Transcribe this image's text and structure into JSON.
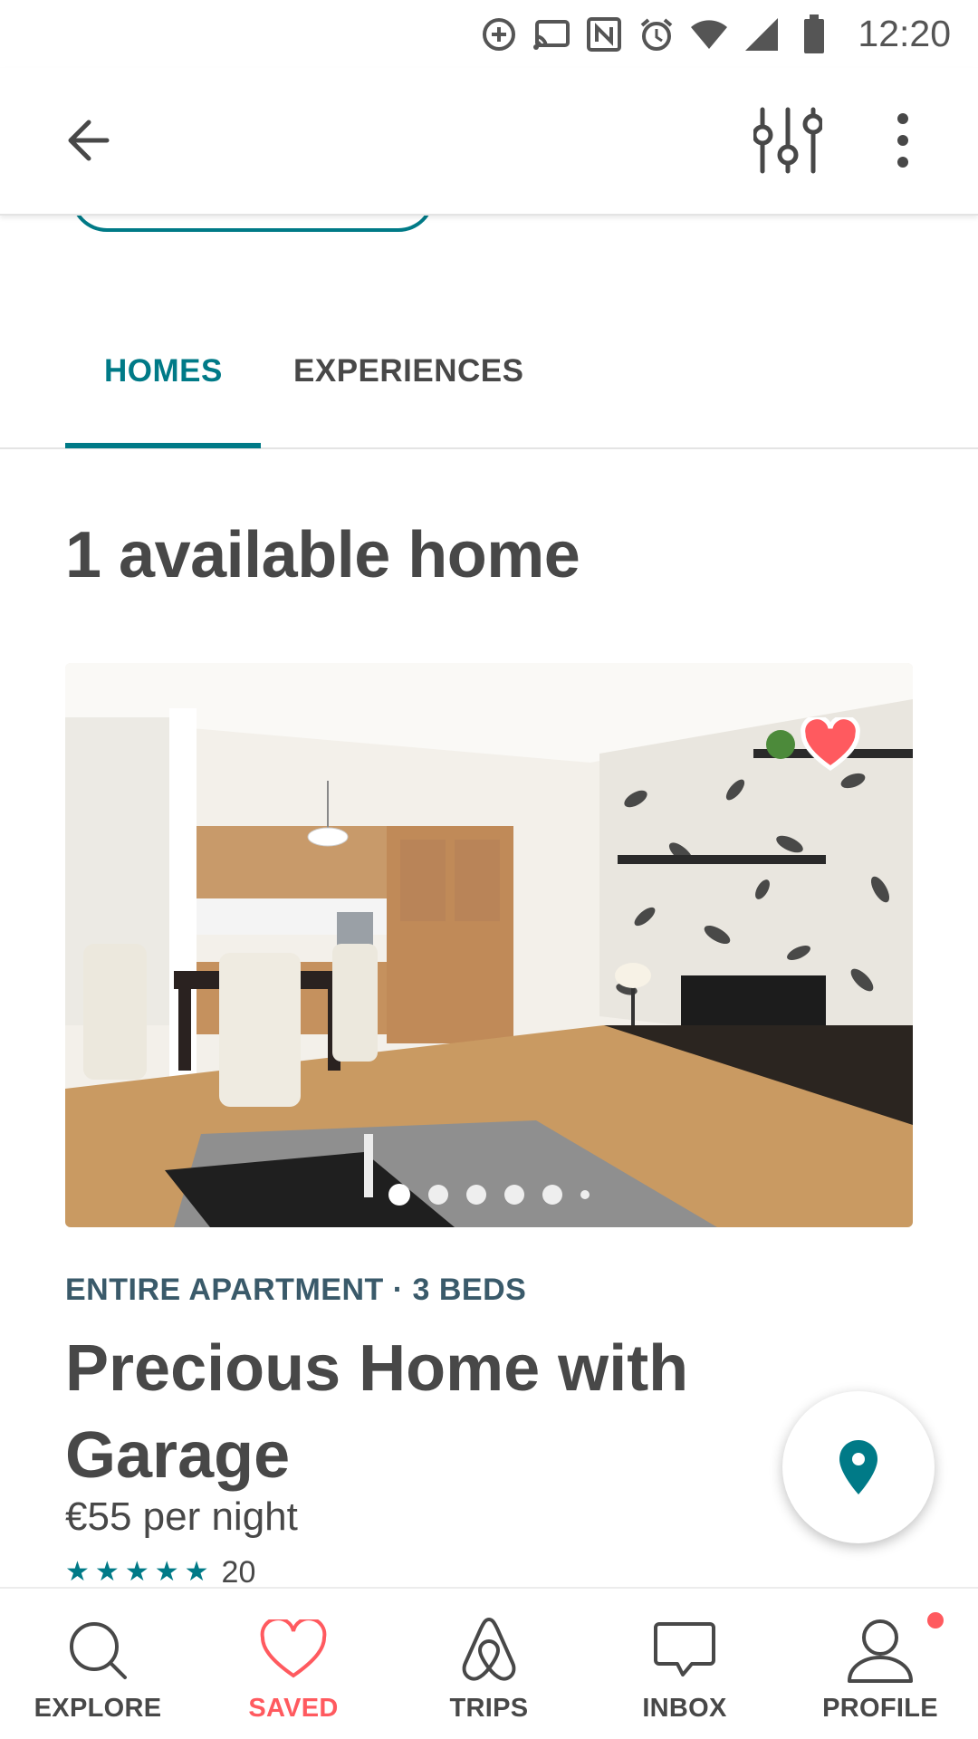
{
  "status_bar": {
    "time": "12:20",
    "icons": [
      "data-saver-icon",
      "cast-icon",
      "nfc-icon",
      "alarm-icon",
      "wifi-icon",
      "cell-signal-icon",
      "battery-icon"
    ]
  },
  "app_bar": {
    "back_icon": "arrow-left-icon",
    "filter_icon": "sliders-icon",
    "more_icon": "more-vertical-icon"
  },
  "tabs": [
    {
      "label": "HOMES",
      "active": true
    },
    {
      "label": "EXPERIENCES",
      "active": false
    }
  ],
  "results": {
    "heading": "1 available home"
  },
  "listing": {
    "meta": "ENTIRE APARTMENT · 3 BEDS",
    "title": "Precious Home with Garage",
    "price": "€55 per night",
    "rating_stars": 5,
    "review_count": "20",
    "favorited": true,
    "photo_count_dots": 6,
    "active_photo_index": 0
  },
  "bottom_nav": [
    {
      "label": "EXPLORE",
      "icon": "search-icon",
      "active": false
    },
    {
      "label": "SAVED",
      "icon": "heart-icon",
      "active": true
    },
    {
      "label": "TRIPS",
      "icon": "airbnb-logo-icon",
      "active": false
    },
    {
      "label": "INBOX",
      "icon": "chat-bubble-icon",
      "active": false
    },
    {
      "label": "PROFILE",
      "icon": "user-icon",
      "active": false,
      "has_notification": true
    }
  ],
  "colors": {
    "accent": "#007a87",
    "brand": "#ff5a5f",
    "text": "#484848"
  }
}
